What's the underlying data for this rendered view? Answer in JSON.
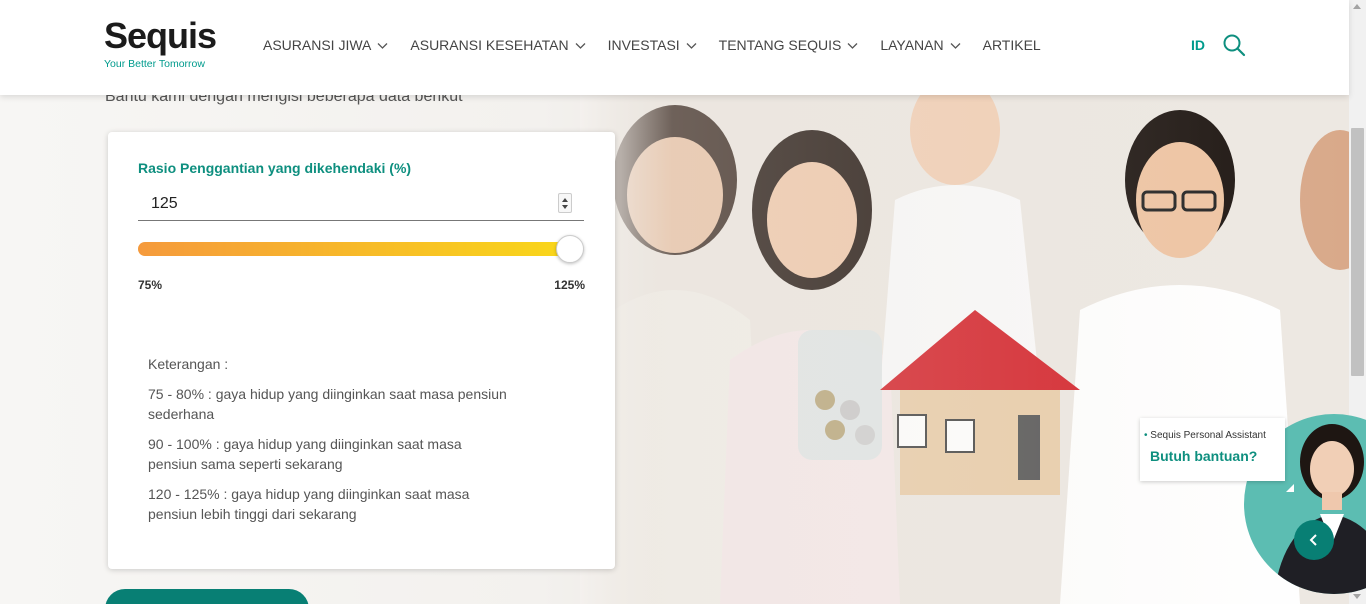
{
  "brand": {
    "name": "Sequis",
    "tagline": "Your Better Tomorrow"
  },
  "nav": {
    "items": [
      {
        "label": "ASURANSI JIWA",
        "has_dropdown": true
      },
      {
        "label": "ASURANSI KESEHATAN",
        "has_dropdown": true
      },
      {
        "label": "INVESTASI",
        "has_dropdown": true
      },
      {
        "label": "TENTANG SEQUIS",
        "has_dropdown": true
      },
      {
        "label": "LAYANAN",
        "has_dropdown": true
      },
      {
        "label": "ARTIKEL",
        "has_dropdown": false
      }
    ],
    "language": "ID",
    "search_icon": "search-icon"
  },
  "page": {
    "subtitle": "Bantu kami dengan mengisi beberapa data berikut"
  },
  "form": {
    "field_label": "Rasio Penggantian yang dikehendaki (%)",
    "input_value": "125",
    "slider": {
      "min": 75,
      "max": 125,
      "value": 125,
      "min_label": "75%",
      "max_label": "125%"
    },
    "notes": {
      "header": "Keterangan :",
      "lines": [
        "75 - 80% : gaya hidup yang diinginkan saat masa pensiun sederhana",
        "90 - 100% : gaya hidup yang diinginkan saat masa pensiun sama seperti sekarang",
        "120 - 125% : gaya hidup yang diinginkan saat masa pensiun lebih tinggi dari sekarang"
      ]
    }
  },
  "assistant": {
    "title": "Sequis Personal Assistant",
    "cta": "Butuh bantuan?"
  },
  "colors": {
    "brand_teal": "#0e8f7f",
    "button_teal": "#087f74",
    "slider_start": "#f59a3c",
    "slider_end": "#f9d71a"
  }
}
